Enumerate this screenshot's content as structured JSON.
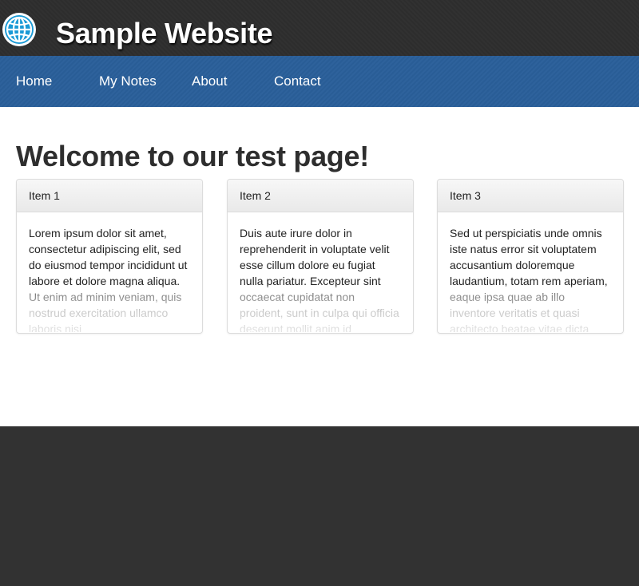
{
  "header": {
    "site_title": "Sample Website",
    "logo_icon": "globe-icon",
    "logo_color": "#1a9ad6"
  },
  "nav": {
    "items": [
      {
        "label": "Home"
      },
      {
        "label": "My Notes"
      },
      {
        "label": "About"
      },
      {
        "label": "Contact"
      }
    ],
    "background_color": "#2a5f9a"
  },
  "main": {
    "heading": "Welcome to our test page!",
    "cards": [
      {
        "title": "Item 1",
        "body": "Lorem ipsum dolor sit amet, consectetur adipiscing elit, sed do eiusmod tempor incididunt ut labore et dolore magna aliqua. Ut enim ad minim veniam, quis nostrud exercitation ullamco laboris nisi"
      },
      {
        "title": "Item 2",
        "body": "Duis aute irure dolor in reprehenderit in voluptate velit esse cillum dolore eu fugiat nulla pariatur. Excepteur sint occaecat cupidatat non proident, sunt in culpa qui officia deserunt mollit anim id"
      },
      {
        "title": "Item 3",
        "body": "Sed ut perspiciatis unde omnis iste natus error sit voluptatem accusantium doloremque laudantium, totam rem aperiam, eaque ipsa quae ab illo inventore veritatis et quasi architecto beatae vitae dicta"
      }
    ]
  }
}
